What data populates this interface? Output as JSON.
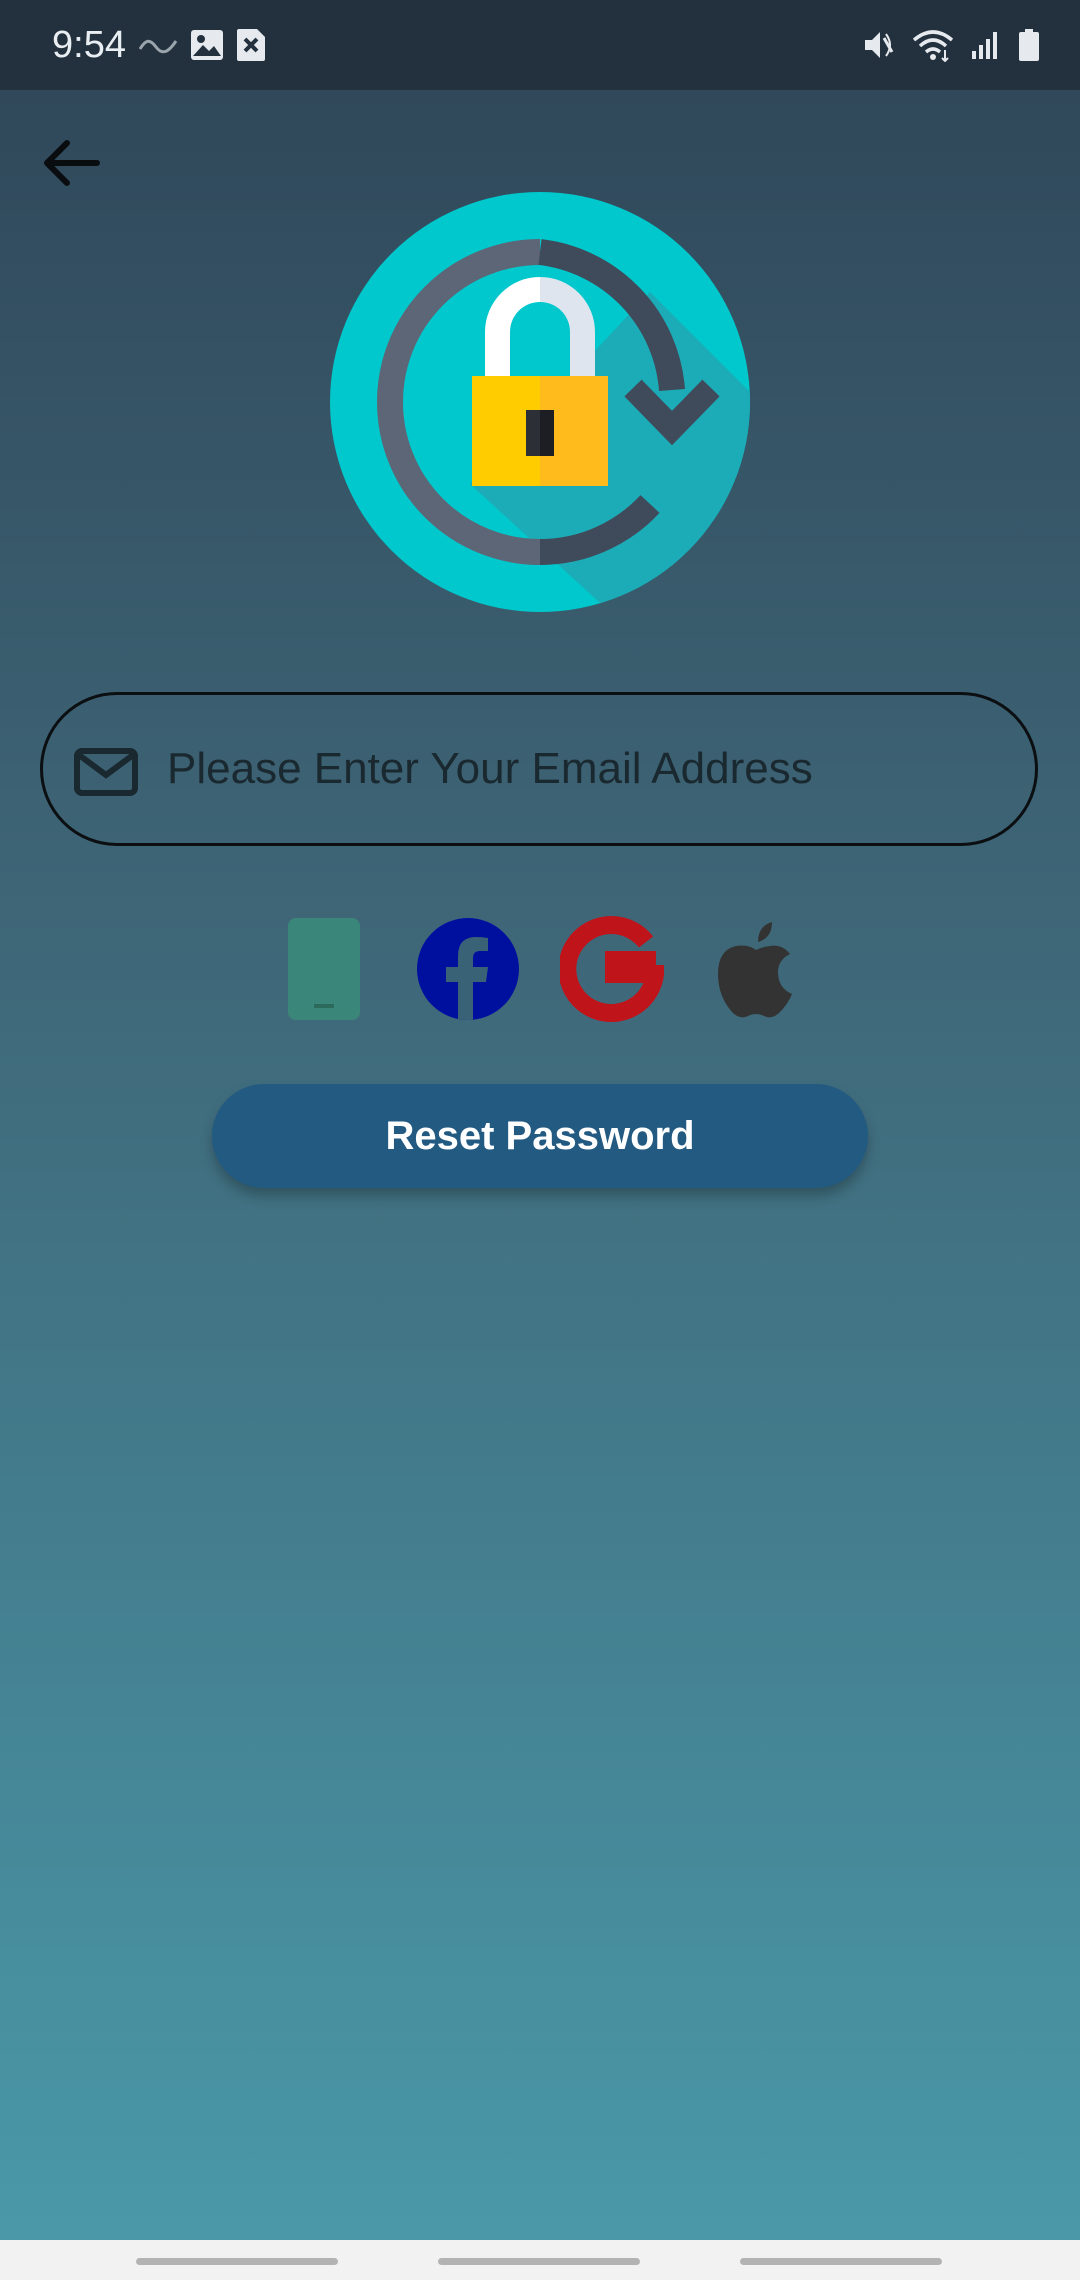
{
  "status_bar": {
    "time": "9:54",
    "icons": [
      "wave-icon",
      "image-icon",
      "close-box-icon",
      "mute-icon",
      "wifi-icon",
      "signal-icon",
      "battery-icon"
    ]
  },
  "header": {
    "back_icon": "arrow-left-icon"
  },
  "logo": {
    "icon": "lock-reset-icon",
    "colors": {
      "circle": "#00c8cc",
      "shackle": "#e8edf4",
      "lock_body": "#ffc20e",
      "ring": "#5d6677"
    }
  },
  "email_field": {
    "placeholder": "Please Enter Your Email Address",
    "value": "",
    "icon": "envelope-icon"
  },
  "social": {
    "items": [
      "phone-icon",
      "facebook-icon",
      "google-icon",
      "apple-icon"
    ],
    "colors": {
      "phone": "#3a8c7a",
      "facebook": "#00109e",
      "google": "#c0141b",
      "apple": "#333333"
    }
  },
  "reset_button": {
    "label": "Reset Password",
    "color": "#235a81"
  },
  "nav_bar": {
    "handles": [
      "recents",
      "home",
      "back"
    ]
  }
}
